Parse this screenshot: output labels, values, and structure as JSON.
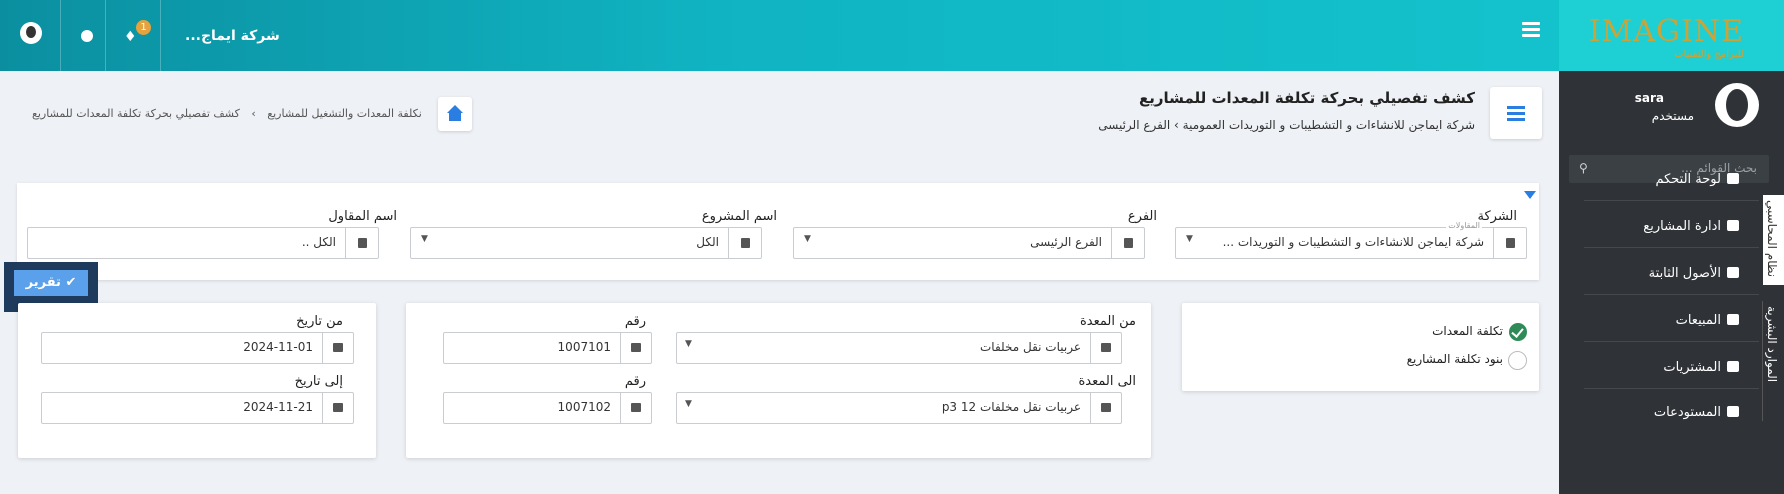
{
  "topbar": {
    "logo": "IMAGINE",
    "logo_sub": "للبرامج والتقنيات",
    "company": "شركة ايماج...",
    "notification_count": "1",
    "icons": [
      "menu-icon",
      "bell-icon",
      "globe-icon",
      "user-icon"
    ]
  },
  "sidebar": {
    "user_name": "sara",
    "user_role": "مستخدم",
    "search_placeholder": "بحث القوائم ...",
    "tabs": [
      "نظام المحاسبي",
      "الموارد البشرية"
    ],
    "items": [
      {
        "label": "لوحة التحكم",
        "icon": "dashboard-icon"
      },
      {
        "label": "ادارة المشاريع",
        "icon": "projects-icon"
      },
      {
        "label": "الأصول الثابتة",
        "icon": "assets-icon"
      },
      {
        "label": "المبيعات",
        "icon": "truck-icon"
      },
      {
        "label": "المشتريات",
        "icon": "purchases-icon"
      },
      {
        "label": "المستودعات",
        "icon": "warehouse-icon"
      }
    ]
  },
  "header": {
    "title": "كشف تفصيلي بحركة تكلفة المعدات للمشاريع",
    "company_path": "شركة ايماجن للانشاءات و التشطيبات و التوريدات العمومية",
    "branch_path": "الفرع الرئيسى",
    "breadcrumb": [
      "نكلفة المعدات والتشغيل للمشاريع",
      "كشف تفصيلي بحركة تكلفة المعدات للمشاريع"
    ]
  },
  "filters": {
    "company_label": "الشركة",
    "company_value": "شركة ايماجن للانشاءات و التشطيبات و التوريدات ...",
    "company_hint": "المقاولات",
    "branch_label": "الفرع",
    "branch_value": "الفرع الرئيسى",
    "project_label": "اسم المشروع",
    "project_value": "الكل",
    "contractor_label": "اسم المقاول",
    "contractor_value": "الكل ..",
    "report_button": "تقرير"
  },
  "report_type": {
    "options": [
      {
        "label": "تكلفة المعدات",
        "selected": true
      },
      {
        "label": "بنود تكلفة المشاريع",
        "selected": false
      }
    ]
  },
  "equipment": {
    "from_label": "من المعدة",
    "from_value": "عربيات نقل مخلفات",
    "to_label": "الى المعدة",
    "to_value": "عربيات نقل مخلفات 12 p3",
    "num_label": "رقم",
    "from_num": "1007101",
    "to_num": "1007102"
  },
  "dates": {
    "from_label": "من تاريخ",
    "from_value": "2024-11-01",
    "to_label": "إلى تاريخ",
    "to_value": "2024-11-21"
  }
}
